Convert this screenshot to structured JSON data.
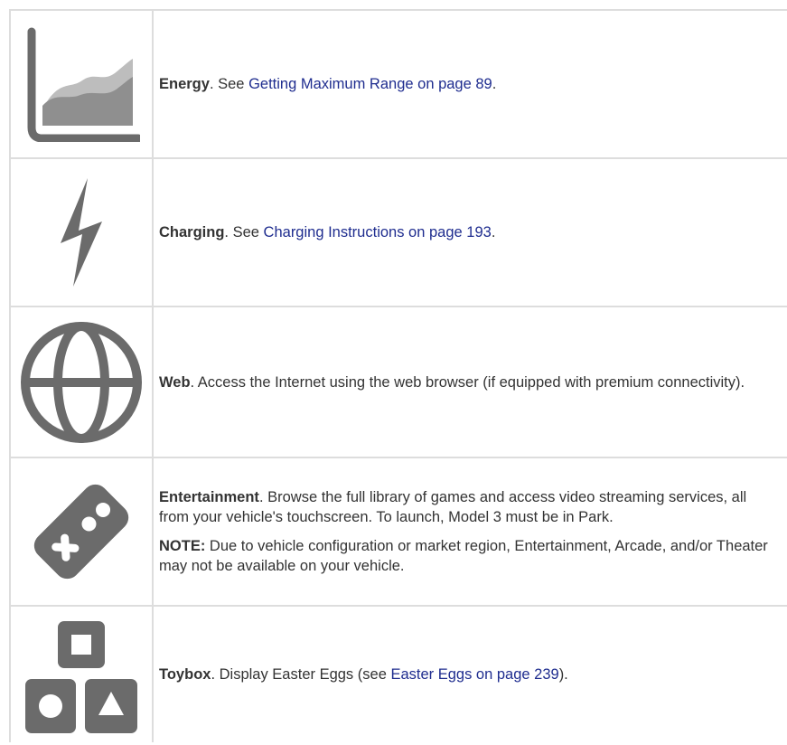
{
  "colors": {
    "icon": "#6b6b6b",
    "icon_light": "#a6a6a6",
    "link": "#1f2d8f",
    "text": "#333333",
    "rule": "#dddddd"
  },
  "rows": [
    {
      "icon": "energy-graph-icon",
      "title": "Energy",
      "pre": ". See ",
      "link": "Getting Maximum Range on page 89",
      "post": "."
    },
    {
      "icon": "lightning-bolt-icon",
      "title": "Charging",
      "pre": ". See ",
      "link": "Charging Instructions on page 193",
      "post": "."
    },
    {
      "icon": "globe-icon",
      "title": "Web",
      "text": ". Access the Internet using the web browser (if equipped with premium connectivity)."
    },
    {
      "icon": "game-controller-icon",
      "title": "Entertainment",
      "text": ". Browse the full library of games and access video streaming services, all from your vehicle's touchscreen. To launch, Model 3 must be in Park.",
      "note_label": "NOTE:",
      "note_text": " Due to vehicle configuration or market region, Entertainment, Arcade, and/or Theater may not be available on your vehicle."
    },
    {
      "icon": "toybox-blocks-icon",
      "title": "Toybox",
      "pre": ". Display Easter Eggs (see ",
      "link": "Easter Eggs on page 239",
      "post": ")."
    }
  ]
}
